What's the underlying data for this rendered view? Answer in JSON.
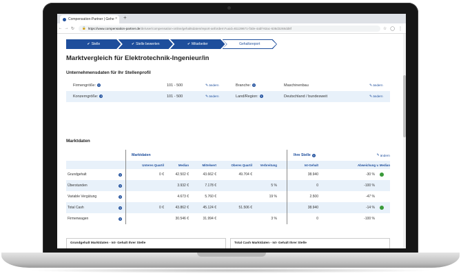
{
  "browser": {
    "tab_title": "Compensation-Partner | Gehe",
    "tab_close": "×",
    "new_tab": "+",
    "url_host": "https://www.compensation-partner.de",
    "url_path": "/de/user/compensation-online/gehaltsdaten/report-anfordern?uuid=81139671-f3de-4abf-92ac-638d3268dd8f"
  },
  "steps": [
    {
      "label": "Stelle",
      "done": true
    },
    {
      "label": "Stelle bewerten",
      "done": true
    },
    {
      "label": "Mitarbeiter",
      "done": true
    },
    {
      "label": "Gehaltsreport",
      "done": false
    }
  ],
  "page": {
    "title": "Marktvergleich für Elektrotechnik-Ingenieur/in",
    "company_section_title": "Unternehmensdaten für Ihr Stellenprofil",
    "change_label": "ändern",
    "company": {
      "firm_size_label": "Firmengröße:",
      "firm_size_value": "101 - 500",
      "group_size_label": "Konzerngröße:",
      "group_size_value": "101 - 500",
      "industry_label": "Branche:",
      "industry_value": "Maschinenbau",
      "region_label": "Land/Region:",
      "region_value": "Deutschland / bundesweit"
    },
    "market_section_title": "Marktdaten",
    "market_group_title": "Marktdaten",
    "own_group_title": "Ihre Stelle",
    "columns": [
      "Unteres Quartil",
      "Median",
      "Mittelwert",
      "Oberes Quartil",
      "Verbreitung",
      "Ist-Gehalt",
      "Abweichung v. Median"
    ],
    "rows": [
      {
        "label": "Grundgehalt",
        "lq": "0 €",
        "median": "42.502 €",
        "mean": "43.662 €",
        "uq": "49.704 €",
        "spread": "",
        "ist": "38.940",
        "dev": "-30 %",
        "dot": true
      },
      {
        "label": "Überstunden",
        "lq": "",
        "median": "3.932 €",
        "mean": "7.178 €",
        "uq": "",
        "spread": "5 %",
        "ist": "0",
        "dev": "-100 %",
        "dot": false
      },
      {
        "label": "Variable Vergütung",
        "lq": "",
        "median": "4.673 €",
        "mean": "5.760 €",
        "uq": "",
        "spread": "19 %",
        "ist": "2.500",
        "dev": "-47 %",
        "dot": false
      },
      {
        "label": "Total Cash",
        "lq": "0 €",
        "median": "43.862 €",
        "mean": "45.124 €",
        "uq": "51.506 €",
        "spread": "",
        "ist": "38.940",
        "dev": "-14 %",
        "dot": true
      },
      {
        "label": "Firmenwagen",
        "lq": "",
        "median": "30.546 €",
        "mean": "31.994 €",
        "uq": "",
        "spread": "3 %",
        "ist": "0",
        "dev": "-100 %",
        "dot": false
      }
    ],
    "card_left_title": "Grundgehalt Marktdaten - Ist- Gehalt Ihrer Stelle",
    "card_right_title": "Total Cash Marktdaten - Ist- Gehalt Ihrer Stelle"
  },
  "colors": {
    "accent": "#1e4e9c",
    "row_alt": "#e8f1fa",
    "ok_dot": "#3a9a3a"
  }
}
